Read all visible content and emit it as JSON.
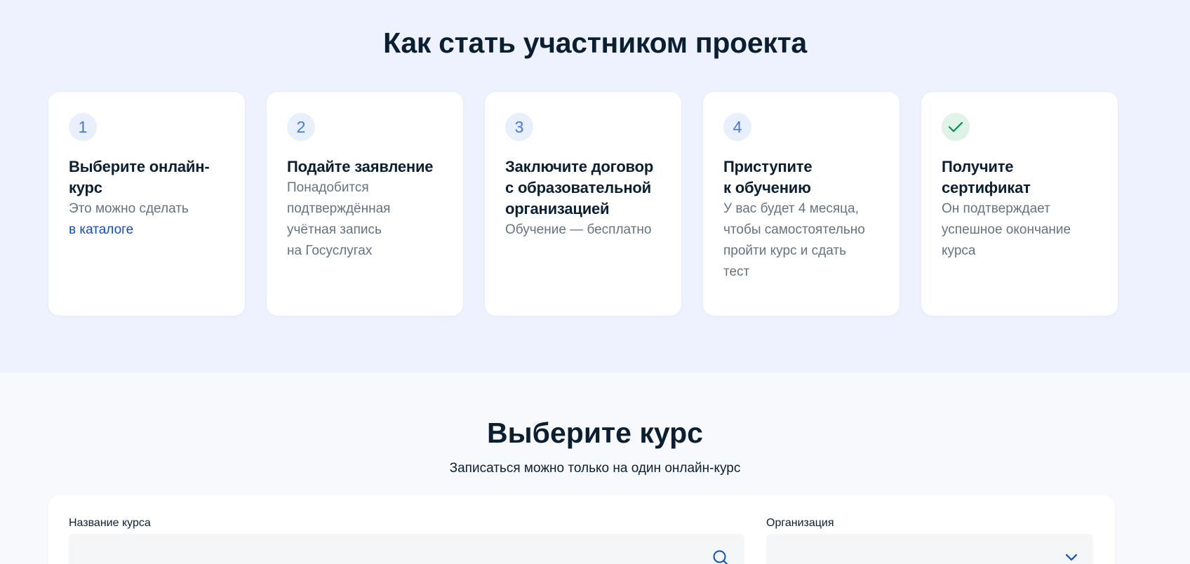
{
  "how": {
    "title": "Как стать участником проекта",
    "steps": [
      {
        "badge": "1",
        "title_lines": [
          "Выберите онлайн-",
          "курс"
        ],
        "text_lines": [
          "Это можно сделать"
        ],
        "link": "в каталоге"
      },
      {
        "badge": "2",
        "title_lines": [
          "Подайте заявление"
        ],
        "text_lines": [
          "Понадобится",
          "подтверждённая",
          "учётная запись",
          "на Госуслугах"
        ]
      },
      {
        "badge": "3",
        "title_lines": [
          "Заключите договор",
          "с образовательной",
          "организацией"
        ],
        "text_lines": [
          "Обучение — бесплатно"
        ]
      },
      {
        "badge": "4",
        "title_lines": [
          "Приступите",
          "к обучению"
        ],
        "text_lines": [
          "У вас будет 4 месяца,",
          "чтобы самостоятельно",
          "пройти курс и сдать",
          "тест"
        ]
      },
      {
        "badge_icon": "check-icon",
        "title_lines": [
          "Получите",
          "сертификат"
        ],
        "text_lines": [
          "Он подтверждает",
          "успешное окончание",
          "курса"
        ]
      }
    ]
  },
  "choose": {
    "title": "Выберите курс",
    "subtitle": "Записаться можно только на один онлайн-курс",
    "course_name_label": "Название курса",
    "course_name_value": "",
    "organization_label": "Организация",
    "organization_value": ""
  },
  "colors": {
    "accent": "#0d4cd3",
    "badge_text": "#4577e7",
    "success": "#0c8d4b",
    "section_bg": "#edf2fe"
  }
}
